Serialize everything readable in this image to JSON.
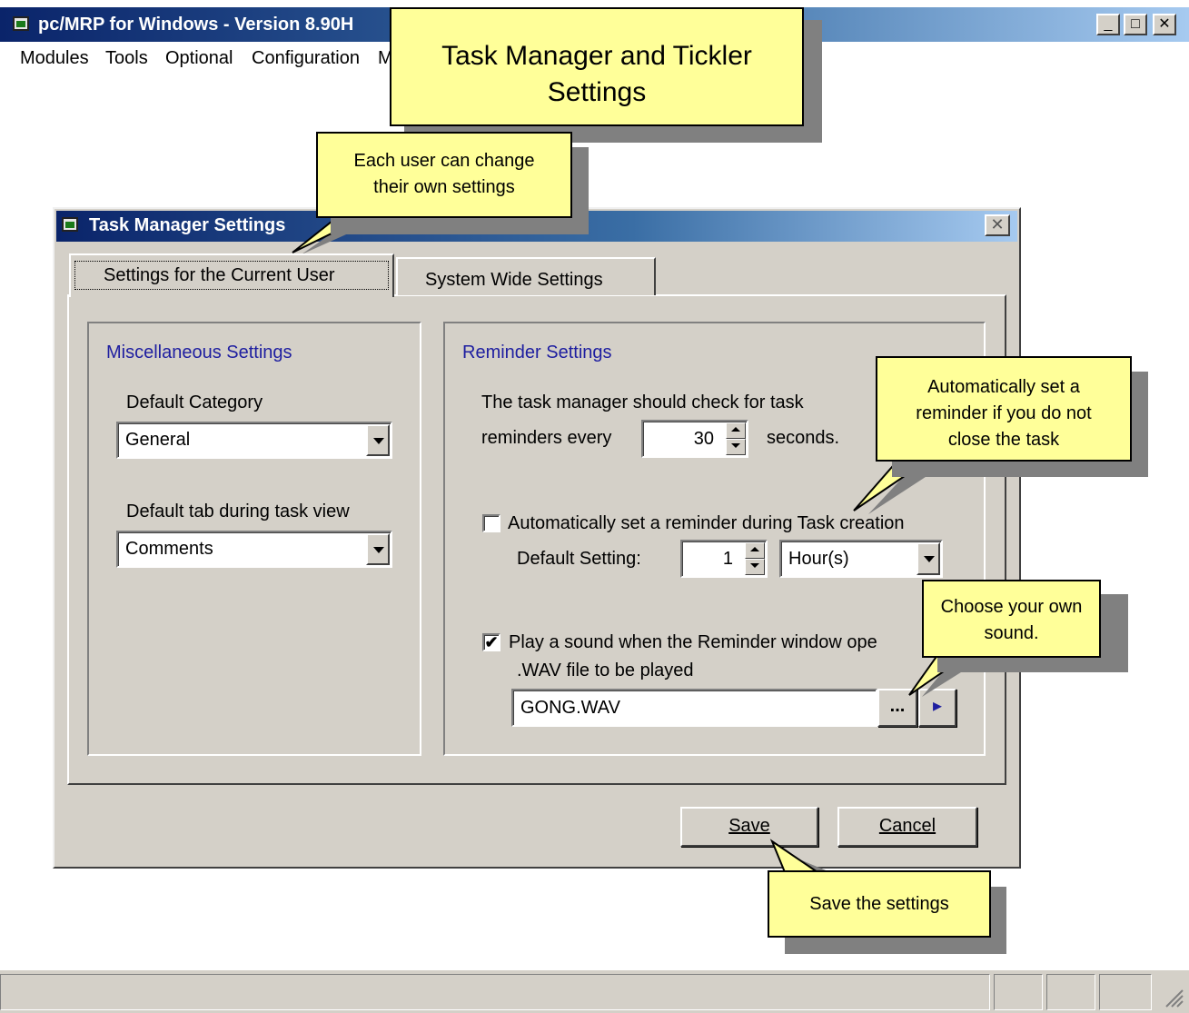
{
  "app": {
    "title": "pc/MRP for Windows - Version 8.90H",
    "window_buttons": [
      "minimize",
      "maximize",
      "close"
    ]
  },
  "menu": [
    "Modules",
    "Tools",
    "Optional",
    "Configuration",
    "M"
  ],
  "dialog": {
    "title": "Task Manager Settings",
    "tabs": [
      {
        "label": "Settings for the Current User",
        "active": true
      },
      {
        "label": "System Wide Settings",
        "active": false
      }
    ],
    "misc": {
      "title": "Miscellaneous Settings",
      "default_category_label": "Default Category",
      "default_category_value": "General",
      "default_tab_label": "Default tab during task view",
      "default_tab_value": "Comments"
    },
    "reminder": {
      "title": "Reminder Settings",
      "check_line1": "The task manager should check for task",
      "check_line2_prefix": "reminders every",
      "check_interval": "30",
      "check_line2_suffix": "seconds.",
      "auto_reminder_label": "Automatically set a reminder during Task creation",
      "auto_reminder_checked": false,
      "default_setting_label": "Default Setting:",
      "default_setting_value": "1",
      "default_setting_unit": "Hour(s)",
      "play_sound_label": "Play a sound when the Reminder window ope",
      "play_sound_checked": true,
      "play_sound_checkmark": "✔",
      "wav_label": ".WAV file to be played",
      "wav_value": "GONG.WAV",
      "browse_label": "...",
      "play_icon": "▸"
    },
    "buttons": {
      "save": "Save",
      "cancel": "Cancel",
      "close_glyph": "✕"
    }
  },
  "callouts": {
    "header": {
      "line1": "Task Manager and Tickler",
      "line2": "Settings"
    },
    "user": {
      "line1": "Each user can change",
      "line2": "their own settings"
    },
    "auto": {
      "line1": "Automatically set a",
      "line2": "reminder if you do not",
      "line3": "close the task"
    },
    "sound": {
      "line1": "Choose your own",
      "line2": "sound."
    },
    "save": {
      "text": "Save the settings"
    }
  },
  "win_glyphs": {
    "minimize": "_",
    "maximize": "□",
    "close": "✕"
  },
  "colors": {
    "title_bar_start": "#0a246a",
    "title_bar_end": "#a6caf0",
    "dialog_face": "#d4d0c8",
    "callout_fill": "#ffff99",
    "group_title": "#1e1ea0"
  }
}
